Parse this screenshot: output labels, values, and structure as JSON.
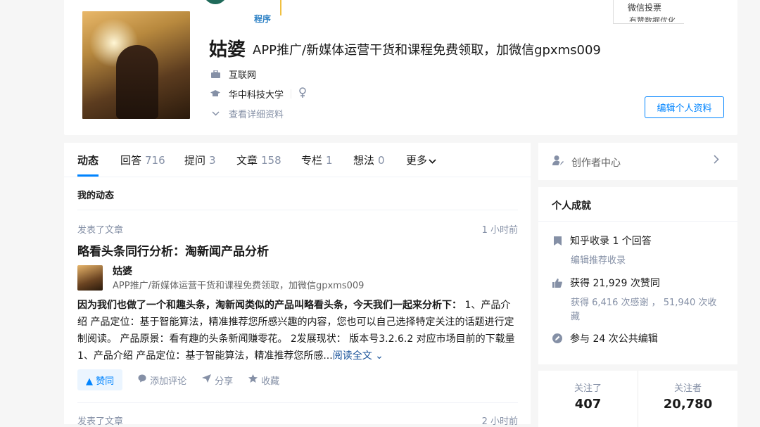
{
  "cover": {
    "fragment_tag": "程序",
    "right_fragment_line1": "微信投票",
    "right_fragment_line2": "有赞数据优化"
  },
  "profile": {
    "name": "姑婆",
    "headline": "APP推广/新媒体运营干货和课程免费领取，加微信gpxms009",
    "industry": "互联网",
    "school": "华中科技大学",
    "gender_icon": "female-icon",
    "more_info": "查看详细资料",
    "edit_button": "编辑个人资料"
  },
  "tabs": [
    {
      "label": "动态",
      "count": ""
    },
    {
      "label": "回答",
      "count": "716"
    },
    {
      "label": "提问",
      "count": "3"
    },
    {
      "label": "文章",
      "count": "158"
    },
    {
      "label": "专栏",
      "count": "1"
    },
    {
      "label": "想法",
      "count": "0"
    },
    {
      "label": "更多",
      "count": ""
    }
  ],
  "feed": {
    "section_title": "我的动态",
    "items": [
      {
        "meta": "发表了文章",
        "time": "1 小时前",
        "title": "略看头条同行分析：淘新闻产品分析",
        "author_name": "姑婆",
        "author_headline": "APP推广/新媒体运营干货和课程免费领取，加微信gpxms009",
        "excerpt_bold": "因为我们也做了一个和趣头条，淘新闻类似的产品叫略看头条，今天我们一起来分析下：",
        "excerpt": " 1、产品介绍 产品定位：基于智能算法，精准推荐您所感兴趣的内容，您也可以自己选择特定关注的话题进行定制阅读。 产品原景：看有趣的头条新闻赚零花。 2发展现状： 版本号3.2.6.2 对应市场目前的下载量 1、产品介绍 产品定位：基于智能算法，精准推荐您所感...",
        "read_more": "阅读全文 ⌄",
        "vote": "▲ 赞同",
        "comment": "添加评论",
        "share": "分享",
        "collect": "收藏"
      },
      {
        "meta": "发表了文章",
        "time": "2 小时前"
      }
    ]
  },
  "sidebar": {
    "creator_center": "创作者中心",
    "achievements_title": "个人成就",
    "collected": "知乎收录 1 个回答",
    "edit_recommend": "编辑推荐收录",
    "upvotes": "获得 21,929 次赞同",
    "thanks": "获得 6,416 次感谢 ， 51,940 次收藏",
    "edits": "参与 24 次公共编辑",
    "following_label": "关注了",
    "following_count": "407",
    "followers_label": "关注者",
    "followers_count": "20,780"
  }
}
